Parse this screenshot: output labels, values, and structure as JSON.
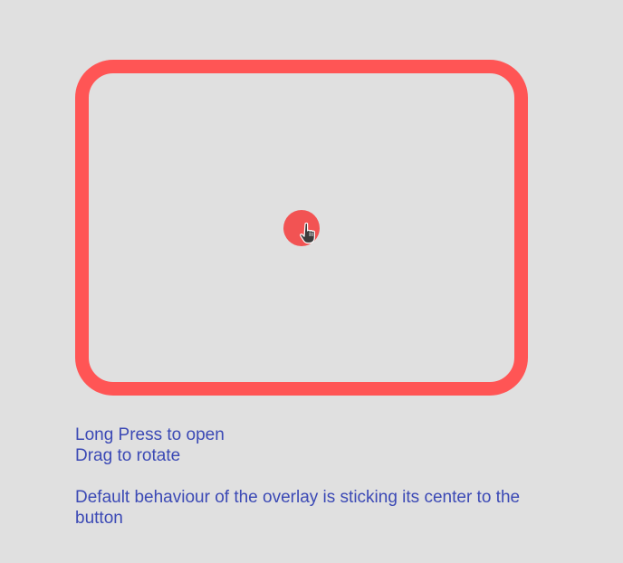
{
  "overlay": {
    "frame_color": "#ff5555",
    "button_color": "#f25353"
  },
  "cursor": {
    "icon": "hand-pointer-icon"
  },
  "instructions": {
    "line1": "Long Press to open",
    "line2": "Drag to rotate",
    "note": "Default behaviour of the overlay is sticking its center to the button",
    "text_color": "#3b49b5"
  }
}
